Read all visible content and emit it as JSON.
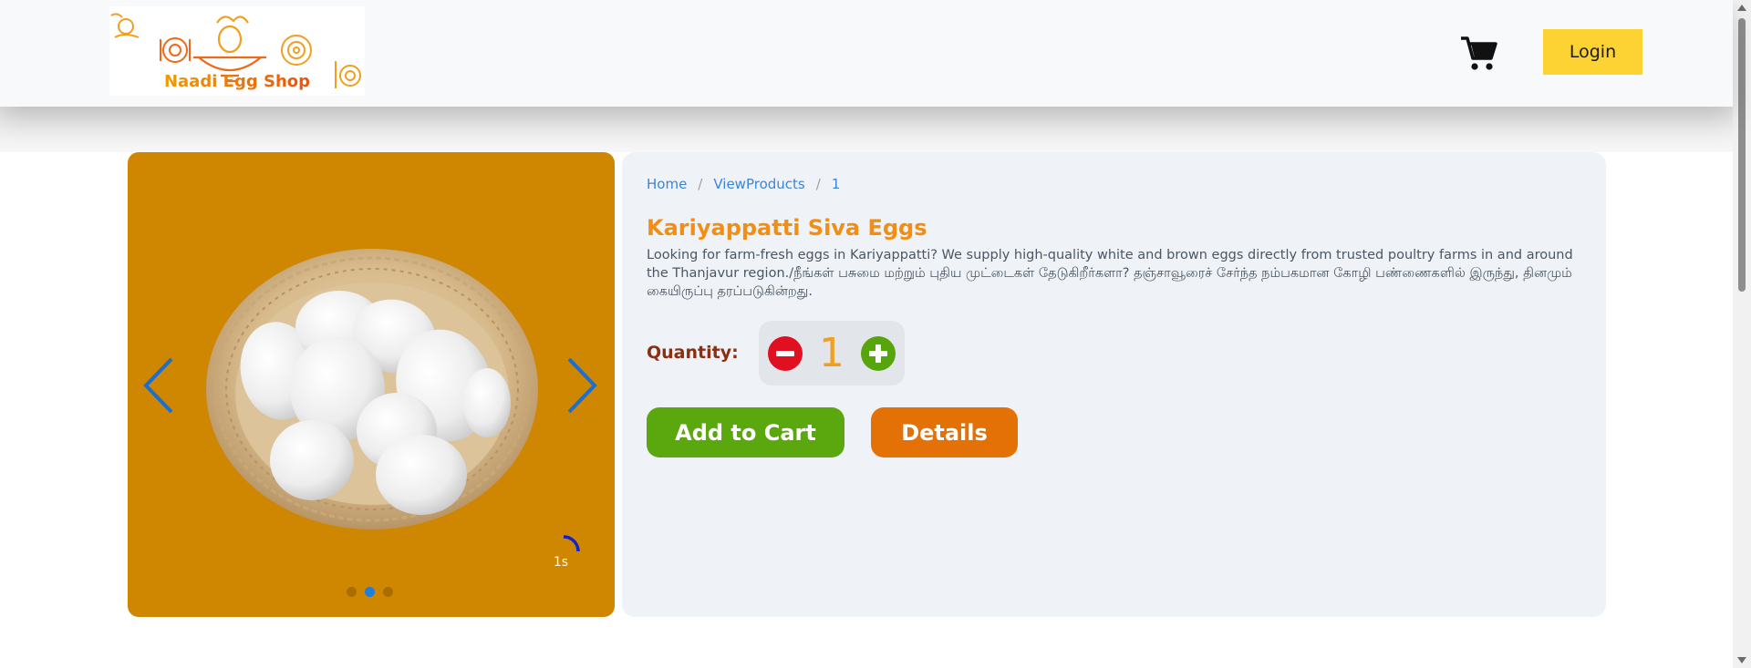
{
  "header": {
    "logo_text": "Naadi Egg Shop",
    "login_label": "Login"
  },
  "breadcrumb": [
    {
      "label": "Home"
    },
    {
      "label": "ViewProducts"
    },
    {
      "label": "1"
    }
  ],
  "breadcrumb_separator": "/",
  "product": {
    "title": "Kariyappatti Siva Eggs",
    "description": "Looking for farm-fresh eggs in Kariyappatti? We supply high-quality white and brown eggs directly from trusted poultry farms in and around the Thanjavur region./நீங்கள் பசுமை மற்றும் புதிய முட்டைகள் தேடுகிறீர்களா? தஞ்சாவூரைச் சேர்ந்த நம்பகமான கோழி பண்ணைகளில் இருந்து, தினமும் கையிருப்பு தரப்படுகின்றது.",
    "quantity_label": "Quantity:",
    "quantity": "1",
    "add_to_cart_label": "Add to Cart",
    "details_label": "Details"
  },
  "carousel": {
    "timer_label": "1s",
    "slide_count": 3,
    "active_slide": 1,
    "background_color": "#cf8600"
  },
  "icons": {
    "cart": "cart-icon",
    "prev": "chevron-left-icon",
    "next": "chevron-right-icon",
    "minus": "minus-circle-icon",
    "plus": "plus-circle-icon"
  },
  "colors": {
    "title": "#f28e14",
    "login_bg": "#fdd334",
    "add_to_cart_bg": "#5aa70e",
    "details_bg": "#e37106",
    "panel_bg": "#eff2f7",
    "breadcrumb_link": "#3a86d6",
    "quantity_label": "#8b2e12"
  }
}
